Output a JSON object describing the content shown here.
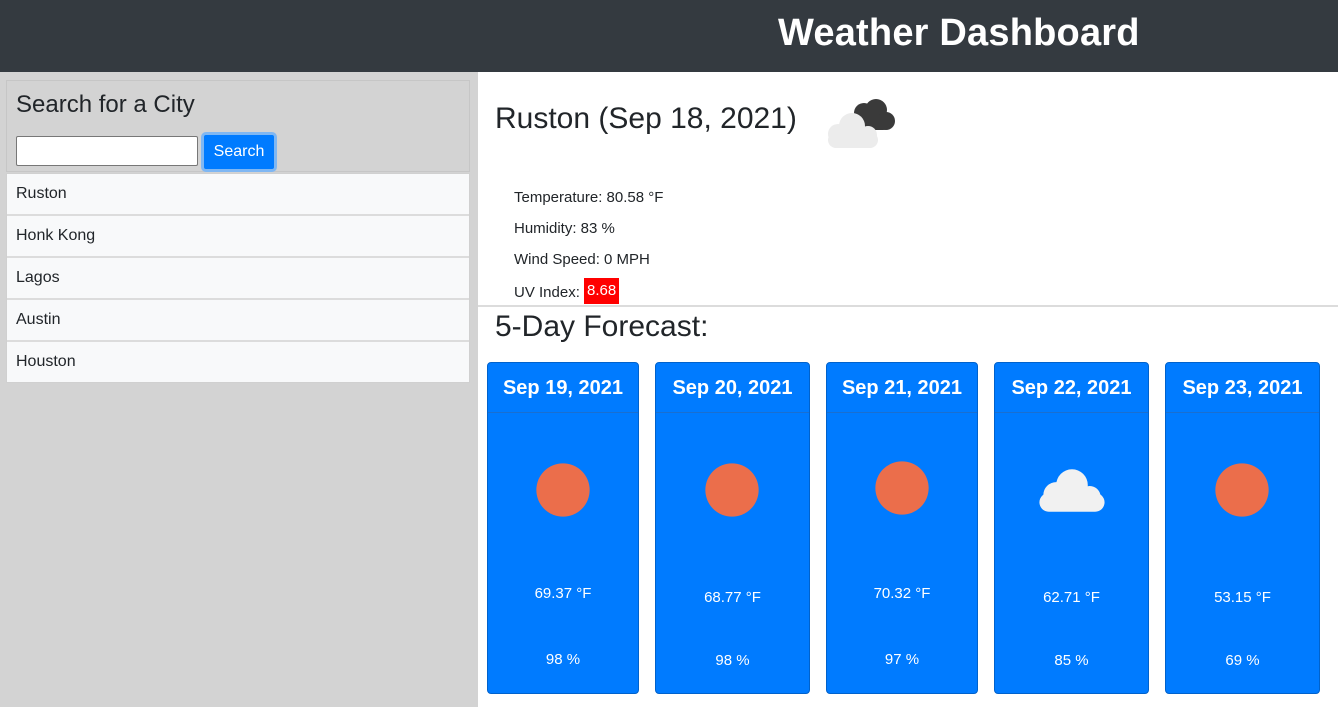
{
  "header": {
    "title": "Weather Dashboard"
  },
  "search": {
    "title": "Search for a City",
    "input_value": "",
    "button_label": "Search"
  },
  "history": [
    "Ruston",
    "Honk Kong",
    "Lagos",
    "Austin",
    "Houston"
  ],
  "current": {
    "title": "Ruston (Sep 18, 2021)",
    "icon": "broken-clouds-icon",
    "temperature": "Temperature: 80.58 °F",
    "humidity": "Humidity: 83 %",
    "wind": "Wind Speed: 0 MPH",
    "uv_label": "UV Index: ",
    "uv_value": "8.68",
    "uv_color": "#ff0000"
  },
  "forecast": {
    "title": "5-Day Forecast:",
    "days": [
      {
        "date": "Sep 19, 2021",
        "icon": "sun-icon",
        "temp": "69.37 °F",
        "humidity": "98 %"
      },
      {
        "date": "Sep 20, 2021",
        "icon": "sun-icon",
        "temp": "68.77 °F",
        "humidity": "98 %"
      },
      {
        "date": "Sep 21, 2021",
        "icon": "sun-icon",
        "temp": "70.32 °F",
        "humidity": "97 %"
      },
      {
        "date": "Sep 22, 2021",
        "icon": "cloud-icon",
        "temp": "62.71 °F",
        "humidity": "85 %"
      },
      {
        "date": "Sep 23, 2021",
        "icon": "sun-icon",
        "temp": "53.15 °F",
        "humidity": "69 %"
      }
    ]
  },
  "colors": {
    "navbar": "#343a40",
    "sidebar": "#d3d3d3",
    "card": "#007bff",
    "sun": "#eb6e4b"
  }
}
